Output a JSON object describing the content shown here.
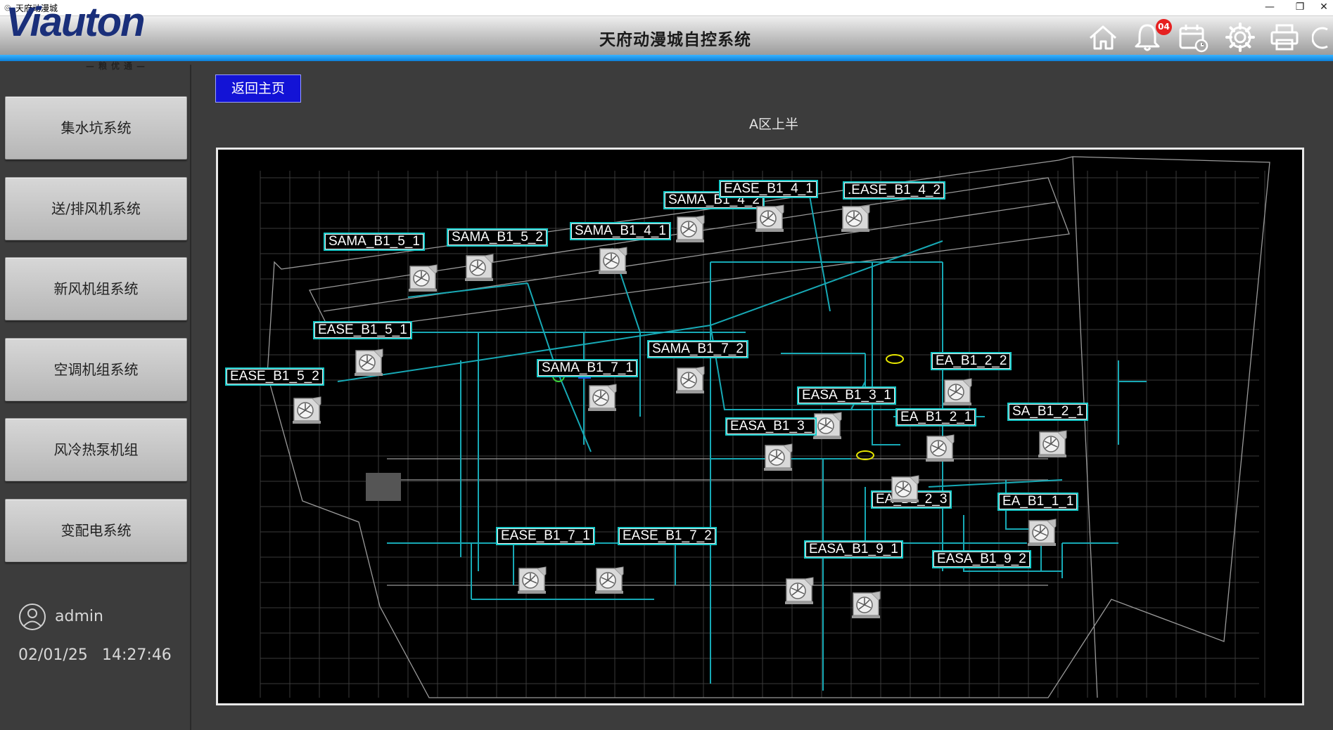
{
  "window": {
    "title": "天府动漫城"
  },
  "header": {
    "logo_text": "Viauton",
    "logo_subtitle": "—粮优通—",
    "title": "天府动漫城自控系统",
    "alarm_count": "04"
  },
  "sidebar": {
    "items": [
      {
        "label": "集水坑系统"
      },
      {
        "label": "送/排风机系统"
      },
      {
        "label": "新风机组系统"
      },
      {
        "label": "空调机组系统"
      },
      {
        "label": "风冷热泵机组"
      },
      {
        "label": "变配电系统"
      }
    ],
    "user": "admin",
    "date": "02/01/25",
    "time": "14:27:46"
  },
  "main": {
    "back_label": "返回主页",
    "zone_title": "A区上半"
  },
  "fans": [
    {
      "label": "SAMA_B1_5_1"
    },
    {
      "label": "SAMA_B1_5_2"
    },
    {
      "label": "SAMA_B1_4_1"
    },
    {
      "label": "SAMA_B1_4_2"
    },
    {
      "label": "EASE_B1_4_1"
    },
    {
      "label": ".EASE_B1_4_2"
    },
    {
      "label": "EASE_B1_5_1"
    },
    {
      "label": "EASE_B1_5_2"
    },
    {
      "label": "SAMA_B1_7_1"
    },
    {
      "label": "SAMA_B1_7_2"
    },
    {
      "label": "EA_B1_2_2"
    },
    {
      "label": "EASA_B1_3_1"
    },
    {
      "label": "EASA_B1_3_"
    },
    {
      "label": "EA_B1_2_1"
    },
    {
      "label": "SA_B1_2_1"
    },
    {
      "label": "EA_B1_2_3"
    },
    {
      "label": "EA_B1_1_1"
    },
    {
      "label": "EASE_B1_7_1"
    },
    {
      "label": "EASE_B1_7_2"
    },
    {
      "label": "EASA_B1_9_1"
    },
    {
      "label": "EASA_B1_9_2"
    }
  ],
  "colors": {
    "accent_blue": "#1313d6",
    "duct_cyan": "#17a9b5",
    "label_border": "#17c9c9",
    "plan_bg": "#000000"
  }
}
